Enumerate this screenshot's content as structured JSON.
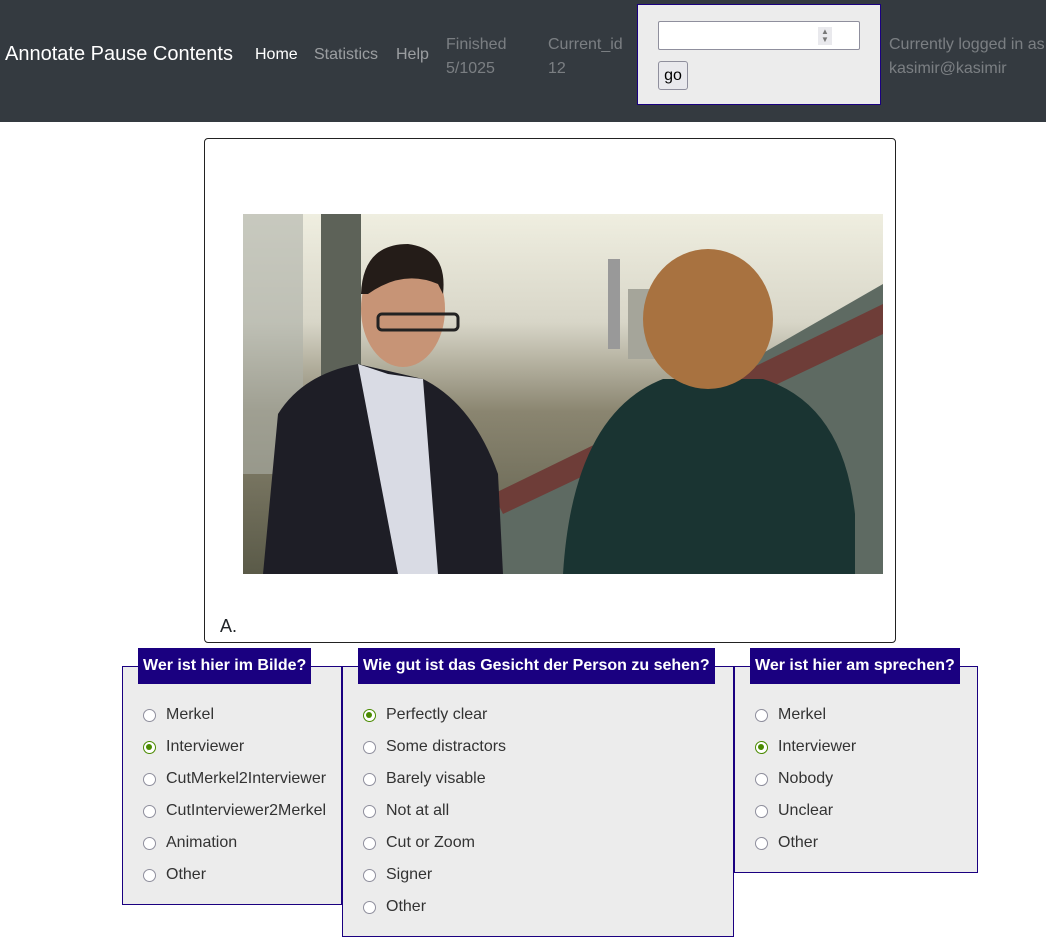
{
  "nav": {
    "brand": "Annotate Pause Contents",
    "links": [
      "Home",
      "Statistics",
      "Help"
    ],
    "finished_label": "Finished",
    "finished_value": "5/1025",
    "current_id_label": "Current_id",
    "current_id_value": "12",
    "id_input_value": "",
    "go_label": "go",
    "logged_in_label": "Currently logged in as",
    "user": "kasimir@kasimir"
  },
  "frame": {
    "caption": "A."
  },
  "questions": [
    {
      "title": "Wer ist hier im Bilde?",
      "options": [
        "Merkel",
        "Interviewer",
        "CutMerkel2Interviewer",
        "CutInterviewer2Merkel",
        "Animation",
        "Other"
      ],
      "selected": "Interviewer"
    },
    {
      "title": "Wie gut ist das Gesicht der Person zu sehen?",
      "options": [
        "Perfectly clear",
        "Some distractors",
        "Barely visable",
        "Not at all",
        "Cut or Zoom",
        "Signer",
        "Other"
      ],
      "selected": "Perfectly clear"
    },
    {
      "title": "Wer ist hier am sprechen?",
      "options": [
        "Merkel",
        "Interviewer",
        "Nobody",
        "Unclear",
        "Other"
      ],
      "selected": "Interviewer"
    }
  ],
  "colors": {
    "navbar": "#343a40",
    "legend": "#1a0080",
    "radio_checked": "#4a8a00"
  }
}
